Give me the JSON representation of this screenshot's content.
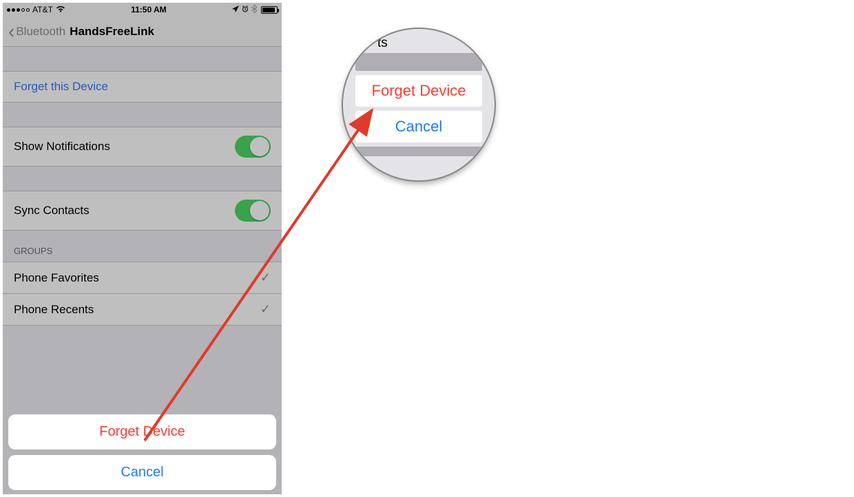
{
  "statusbar": {
    "carrier": "AT&T",
    "time": "11:50 AM"
  },
  "navbar": {
    "back_label": "Bluetooth",
    "title": "HandsFreeLink"
  },
  "cells": {
    "forget_this_device": "Forget this Device",
    "show_notifications": "Show Notifications",
    "sync_contacts": "Sync Contacts"
  },
  "groups": {
    "header": "GROUPS",
    "phone_favorites": "Phone Favorites",
    "phone_recents": "Phone Recents"
  },
  "actionsheet": {
    "forget_device": "Forget Device",
    "cancel": "Cancel"
  },
  "magnifier": {
    "partial_top": "ts",
    "forget_device": "Forget Device",
    "cancel": "Cancel"
  }
}
